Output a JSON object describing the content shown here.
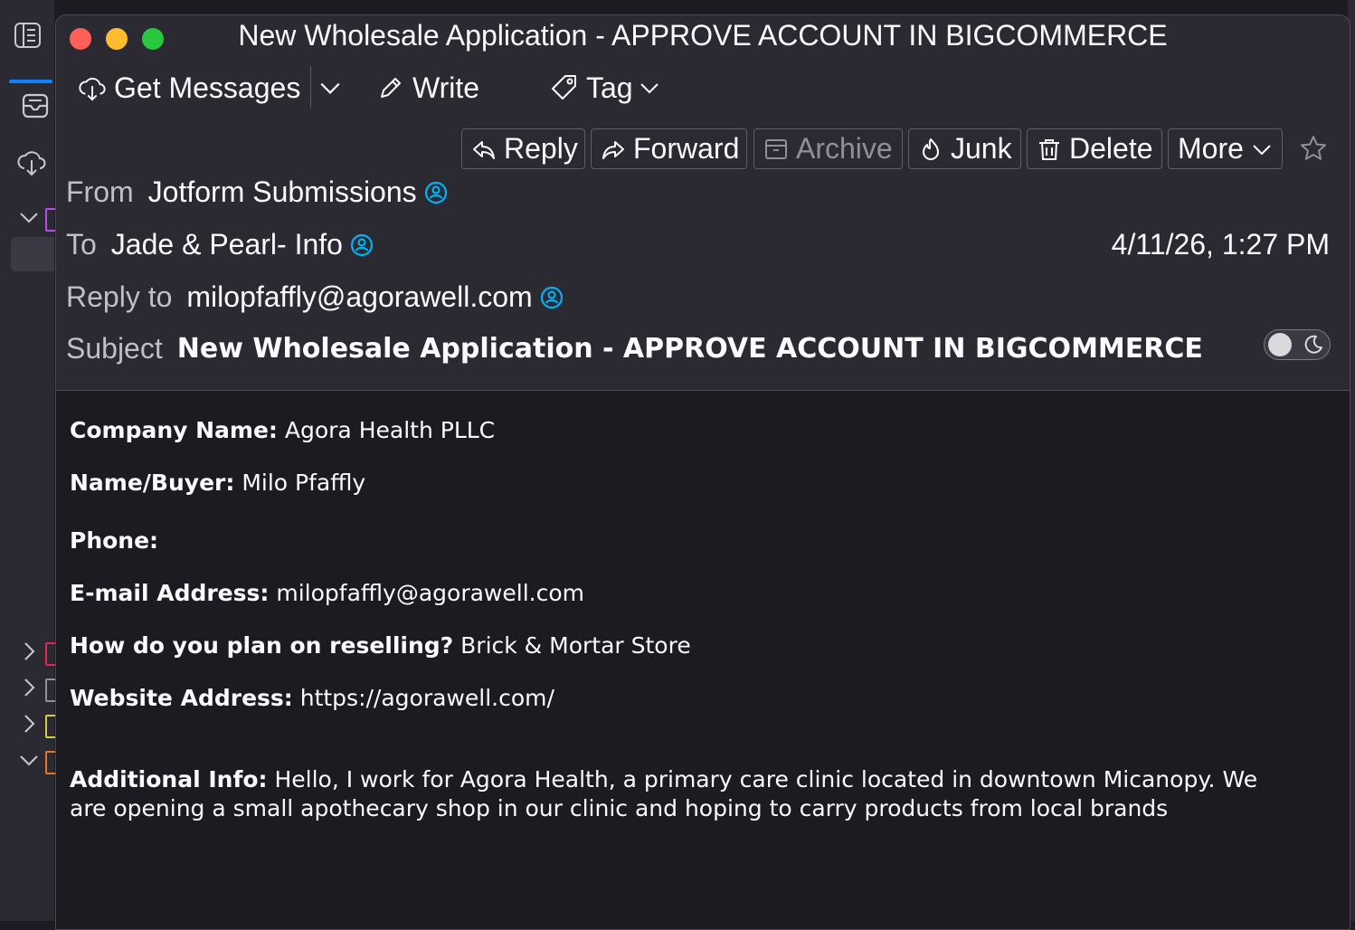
{
  "window": {
    "title": "New Wholesale Application - APPROVE ACCOUNT IN BIGCOMMERCE"
  },
  "toolbar": {
    "get_messages": "Get Messages",
    "write": "Write",
    "tag": "Tag"
  },
  "actions": {
    "reply": "Reply",
    "forward": "Forward",
    "archive": "Archive",
    "junk": "Junk",
    "delete": "Delete",
    "more": "More"
  },
  "header": {
    "from_label": "From",
    "from_value": "Jotform Submissions",
    "to_label": "To",
    "to_value": "Jade & Pearl- Info",
    "replyto_label": "Reply to",
    "replyto_value": "milopfaffly@agorawell.com",
    "subject_label": "Subject",
    "subject_value": "New Wholesale Application - APPROVE ACCOUNT IN BIGCOMMERCE",
    "date": "4/11/26, 1:27 PM"
  },
  "body": {
    "fields": [
      {
        "label": "Company Name:",
        "value": "Agora Health PLLC"
      },
      {
        "label": "Name/Buyer:",
        "value": "Milo Pfaffly"
      },
      {
        "label": "Phone:",
        "value": ""
      },
      {
        "label": "E-mail Address:",
        "value": "milopfaffly@agorawell.com"
      },
      {
        "label": "How do you plan on reselling?",
        "value": "Brick & Mortar Store"
      },
      {
        "label": "Website Address:",
        "value": "https://agorawell.com/"
      },
      {
        "label": "Additional Info:",
        "value": "Hello, I work for Agora Health, a primary care clinic located in downtown Micanopy. We are opening a small apothecary shop in our clinic and hoping to carry products from local brands"
      }
    ]
  },
  "colors": {
    "window_bg": "#2b2a33",
    "body_bg": "#1c1b22",
    "address_icon": "#00b3f4",
    "accent": "#0a84ff"
  },
  "icons": [
    "spaces-toolbar-icon",
    "mail-icon",
    "cloud-download-icon",
    "pencil-icon",
    "tag-icon",
    "chevron-down-icon",
    "reply-icon",
    "forward-icon",
    "archive-icon",
    "junk-icon",
    "trash-icon",
    "star-icon",
    "address-book-icon",
    "moon-icon"
  ]
}
